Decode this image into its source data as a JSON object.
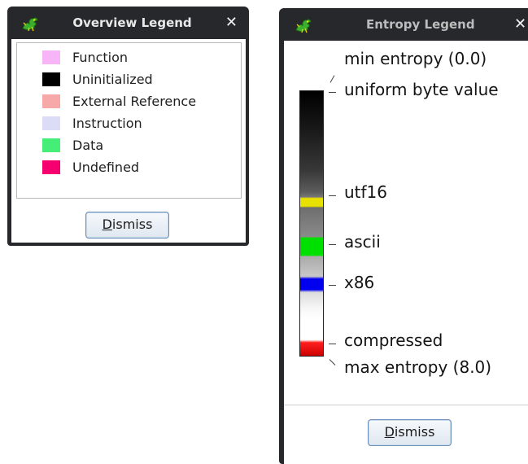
{
  "overview_window": {
    "title": "Overview Legend",
    "close_glyph": "✕",
    "icon": "dragon-icon",
    "items": [
      {
        "label": "Function",
        "color": "#f7b4f7"
      },
      {
        "label": "Uninitialized",
        "color": "#000000"
      },
      {
        "label": "External Reference",
        "color": "#f7a8a8"
      },
      {
        "label": "Instruction",
        "color": "#dcdcf7"
      },
      {
        "label": "Data",
        "color": "#44ee77"
      },
      {
        "label": "Undefined",
        "color": "#f5006e"
      }
    ],
    "dismiss_mnemonic": "D",
    "dismiss_rest": "ismiss"
  },
  "entropy_window": {
    "title": "Entropy Legend",
    "close_glyph": "✕",
    "icon": "dragon-icon",
    "labels": {
      "min": "min entropy (0.0)",
      "uniform": "uniform byte value",
      "utf16": "utf16",
      "ascii": "ascii",
      "x86": "x86",
      "compressed": "compressed",
      "max": "max entropy (8.0)"
    },
    "dismiss_mnemonic": "D",
    "dismiss_rest": "ismiss"
  }
}
